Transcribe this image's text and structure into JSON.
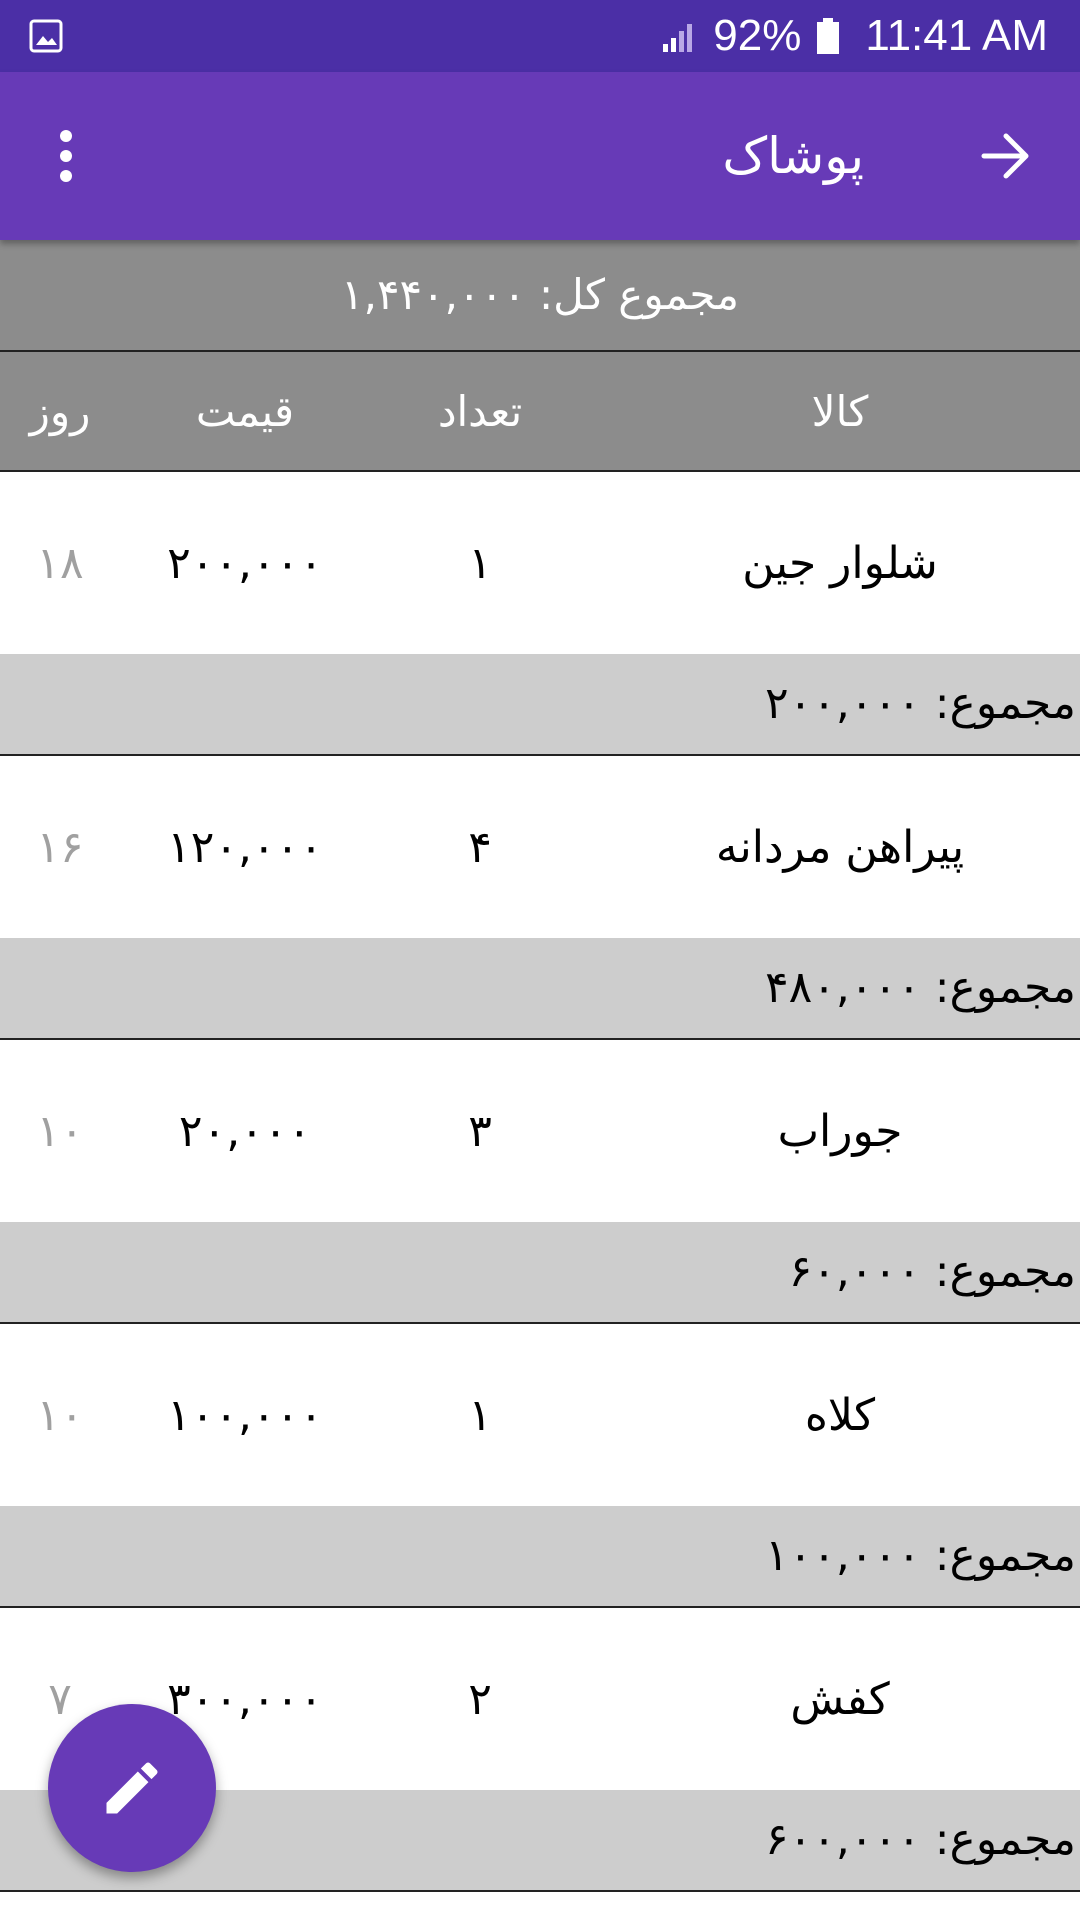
{
  "status_bar": {
    "battery_percent": "92%",
    "time": "11:41 AM",
    "icons": [
      "gallery-icon",
      "signal-icon",
      "battery-icon"
    ]
  },
  "app_bar": {
    "title": "پوشاک",
    "icons": [
      "back-arrow-icon",
      "more-vert-icon"
    ]
  },
  "total": {
    "text": "مجموع کل: ۱,۴۴۰,۰۰۰"
  },
  "table": {
    "headers": {
      "item": "کالا",
      "quantity": "تعداد",
      "price": "قیمت",
      "day": "روز"
    },
    "rows": [
      {
        "item": "شلوار جین",
        "quantity": "۱",
        "price": "۲۰۰,۰۰۰",
        "day": "۱۸",
        "subtotal": "مجموع: ۲۰۰,۰۰۰"
      },
      {
        "item": "پیراهن مردانه",
        "quantity": "۴",
        "price": "۱۲۰,۰۰۰",
        "day": "۱۶",
        "subtotal": "مجموع: ۴۸۰,۰۰۰"
      },
      {
        "item": "جوراب",
        "quantity": "۳",
        "price": "۲۰,۰۰۰",
        "day": "۱۰",
        "subtotal": "مجموع: ۶۰,۰۰۰"
      },
      {
        "item": "کلاه",
        "quantity": "۱",
        "price": "۱۰۰,۰۰۰",
        "day": "۱۰",
        "subtotal": "مجموع: ۱۰۰,۰۰۰"
      },
      {
        "item": "کفش",
        "quantity": "۲",
        "price": "۳۰۰,۰۰۰",
        "day": "۷",
        "subtotal": "مجموع: ۶۰۰,۰۰۰"
      }
    ]
  },
  "fab": {
    "icon": "edit-icon"
  },
  "colors": {
    "primary": "#673ab7",
    "primary_dark": "#4b2fa6",
    "header_gray": "#8c8c8c",
    "subtotal_gray": "#cdcdcd",
    "day_text": "#a0a0a0"
  }
}
